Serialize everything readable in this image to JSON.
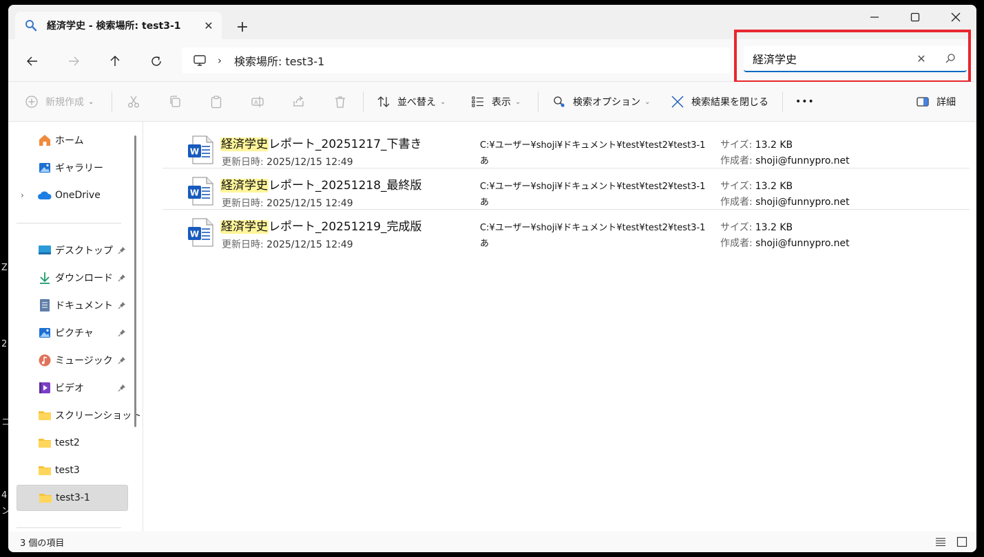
{
  "window": {
    "tab_title": "経済学史 - 検索場所: test3-1",
    "tab_close": "✕",
    "new_tab": "+",
    "controls": {
      "minimize": "—",
      "maximize": "☐",
      "close": "✕"
    }
  },
  "address": {
    "crumb": "検索場所: test3-1",
    "chevron": "›"
  },
  "search": {
    "value": "経済学史",
    "clear": "✕"
  },
  "toolbar": {
    "new": "新規作成",
    "sort": "並べ替え",
    "view": "表示",
    "search_options": "検索オプション",
    "close_search": "検索結果を閉じる",
    "more": "•••",
    "details": "詳細",
    "caret": "⌄"
  },
  "sidebar": {
    "home": "ホーム",
    "gallery": "ギャラリー",
    "onedrive": "OneDrive",
    "expand": "›",
    "desktop": "デスクトップ",
    "downloads": "ダウンロード",
    "documents": "ドキュメント",
    "pictures": "ピクチャ",
    "music": "ミュージック",
    "videos": "ビデオ",
    "screenshots": "スクリーンショット",
    "test2": "test2",
    "test3": "test3",
    "test3_1": "test3-1"
  },
  "labels": {
    "modified": "更新日時:",
    "size": "サイズ:",
    "author": "作成者:"
  },
  "files": [
    {
      "highlight": "経済学史",
      "rest": "レポート_20251217_下書き",
      "date": "2025/12/15 12:49",
      "path": "C:¥ユーザー¥shoji¥ドキュメント¥test¥test2¥test3-1",
      "path2": "あ",
      "size": "13.2 KB",
      "author": "shoji@funnypro.net"
    },
    {
      "highlight": "経済学史",
      "rest": "レポート_20251218_最終版",
      "date": "2025/12/15 12:49",
      "path": "C:¥ユーザー¥shoji¥ドキュメント¥test¥test2¥test3-1",
      "path2": "あ",
      "size": "13.2 KB",
      "author": "shoji@funnypro.net"
    },
    {
      "highlight": "経済学史",
      "rest": "レポート_20251219_完成版",
      "date": "2025/12/15 12:49",
      "path": "C:¥ユーザー¥shoji¥ドキュメント¥test¥test2¥test3-1",
      "path2": "あ",
      "size": "13.2 KB",
      "author": "shoji@funnypro.net"
    }
  ],
  "status": {
    "count": "3 個の項目"
  },
  "desktop_edge": {
    "a": "Z",
    "b": "2",
    "c": "コ",
    "d": "4",
    "e": "ン"
  },
  "colors": {
    "accent": "#0067c0",
    "highlight": "#fff59a",
    "annotation": "#e8262e",
    "word_blue": "#185abd"
  }
}
